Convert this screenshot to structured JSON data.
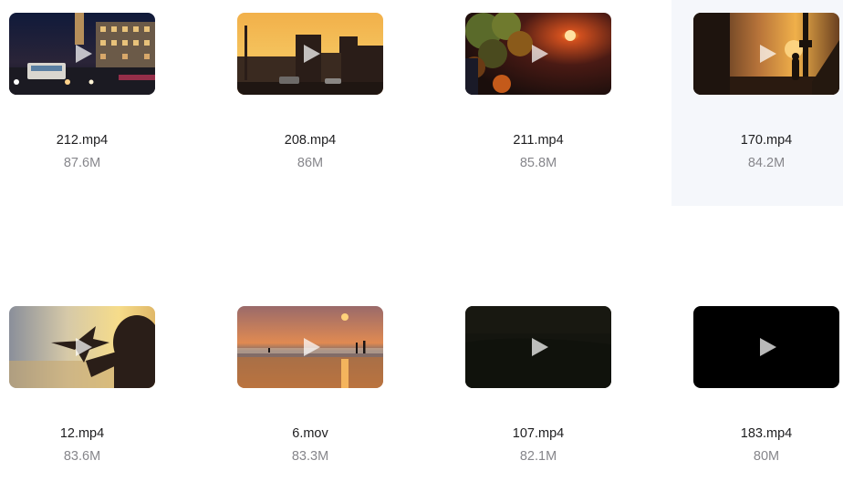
{
  "files": [
    {
      "name": "212.mp4",
      "size": "87.6M",
      "thumbnail": "night-city-street-with-bus"
    },
    {
      "name": "208.mp4",
      "size": "86M",
      "thumbnail": "sunset-over-city-street"
    },
    {
      "name": "211.mp4",
      "size": "85.8M",
      "thumbnail": "sunset-through-autumn-leaves"
    },
    {
      "name": "170.mp4",
      "size": "84.2M",
      "thumbnail": "person-walking-at-sunset"
    },
    {
      "name": "12.mp4",
      "size": "83.6M",
      "thumbnail": "silhouette-with-paper-plane"
    },
    {
      "name": "6.mov",
      "size": "83.3M",
      "thumbnail": "beach-sunset"
    },
    {
      "name": "107.mp4",
      "size": "82.1M",
      "thumbnail": "dark-scene"
    },
    {
      "name": "183.mp4",
      "size": "80M",
      "thumbnail": "black-frame"
    }
  ],
  "highlighted_index": 3
}
